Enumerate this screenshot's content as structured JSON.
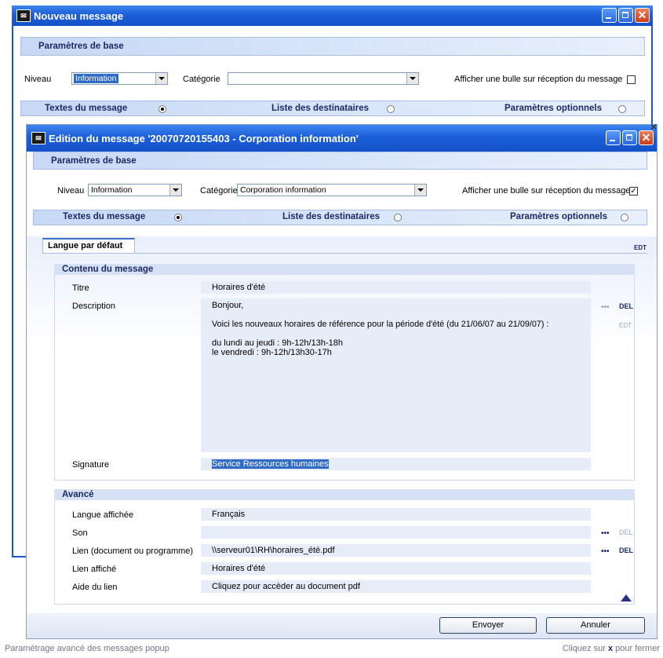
{
  "back_window": {
    "title": "Nouveau message",
    "section_base": "Paramètres de base",
    "niveau_label": "Niveau",
    "niveau_value": "Information",
    "categorie_label": "Catégorie",
    "categorie_value": "",
    "bulle_label": "Afficher une bulle sur réception du message",
    "tab_textes": "Textes du message",
    "tab_destinataires": "Liste des destinataires",
    "tab_parametres": "Paramètres optionnels"
  },
  "front_window": {
    "title": "Edition du message '20070720155403 - Corporation information'",
    "section_base": "Paramètres de base",
    "niveau_label": "Niveau",
    "niveau_value": "Information",
    "categorie_label": "Catégorie",
    "categorie_value": "Corporation information",
    "bulle_label": "Afficher une bulle sur réception du message",
    "bulle_checked": "✓",
    "tab_textes": "Textes du message",
    "tab_destinataires": "Liste des destinataires",
    "tab_parametres": "Paramètres optionnels",
    "language_tab": "Langue par défaut",
    "contenu": {
      "header": "Contenu du message",
      "titre_label": "Titre",
      "titre_value": "Horaires d'été",
      "description_label": "Description",
      "description_lines": [
        "Bonjour,",
        "",
        "Voici les nouveaux horaires de référence pour la période d'été (du 21/06/07 au 21/09/07) :",
        "",
        "du lundi au jeudi : 9h-12h/13h-18h",
        "le vendredi : 9h-12h/13h30-17h"
      ],
      "signature_label": "Signature",
      "signature_value": "Service Ressources humaines"
    },
    "avance": {
      "header": "Avancé",
      "langue_label": "Langue affichée",
      "langue_value": "Français",
      "son_label": "Son",
      "son_value": "",
      "lien_label": "Lien (document ou programme)",
      "lien_value": "\\\\serveur01\\RH\\horaires_été.pdf",
      "lien_affiche_label": "Lien affiché",
      "lien_affiche_value": "Horaires d'été",
      "aide_label": "Aide du lien",
      "aide_value": "Cliquez pour accèder au document pdf"
    },
    "envoyer": "Envoyer",
    "annuler": "Annuler"
  },
  "icons": {
    "edit_translate": "EDT",
    "edit_language": "DEL",
    "dots": "•••"
  },
  "status_left": "Paramétrage avancé des messages popup",
  "status_right_prefix": "Cliquez sur",
  "status_right_x": "x",
  "status_right_suffix": "pour fermer",
  "colors": {
    "titlebar": "#1d5fd8",
    "band": "#c7d8f5",
    "field": "#e6ecf8",
    "text_dark": "#1c2a66",
    "selection": "#316ac5"
  }
}
